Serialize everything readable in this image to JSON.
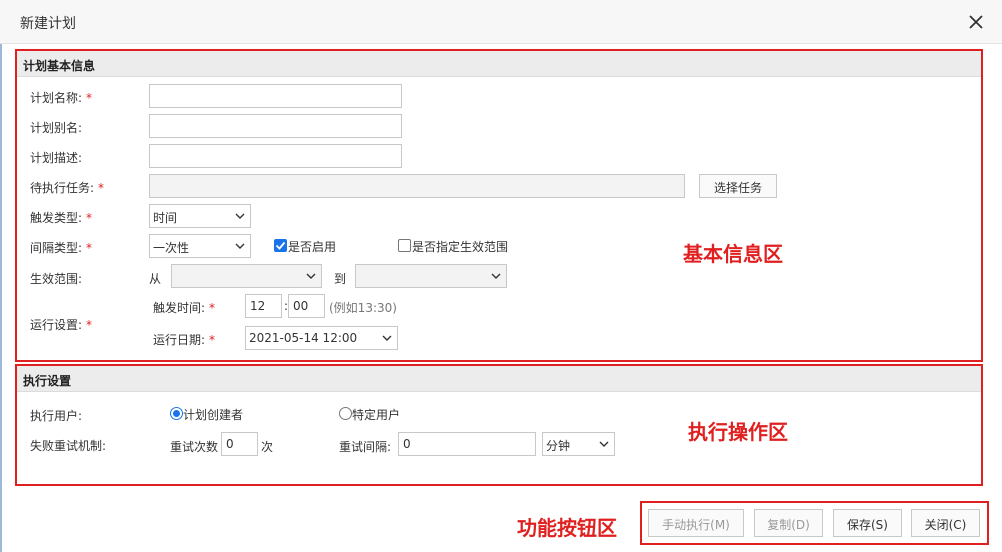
{
  "dialog": {
    "title": "新建计划"
  },
  "basic": {
    "section_title": "计划基本信息",
    "plan_name_label": "计划名称:",
    "plan_name_value": "",
    "plan_alias_label": "计划别名:",
    "plan_alias_value": "",
    "plan_desc_label": "计划描述:",
    "plan_desc_value": "",
    "pending_task_label": "待执行任务:",
    "pending_task_value": "",
    "select_task_button": "选择任务",
    "trigger_type_label": "触发类型:",
    "trigger_type_value": "时间",
    "interval_type_label": "间隔类型:",
    "interval_type_value": "一次性",
    "enable_label": "是否启用",
    "enable_checked": true,
    "specify_range_label": "是否指定生效范围",
    "specify_range_checked": false,
    "effective_range_label": "生效范围:",
    "from_label": "从",
    "to_label": "到",
    "from_value": "",
    "to_value": "",
    "run_settings_label": "运行设置:",
    "trigger_time_label": "触发时间:",
    "hour_value": "12",
    "minute_value": "00",
    "time_separator": ":",
    "time_example": "(例如13:30)",
    "run_date_label": "运行日期:",
    "run_date_value": "2021-05-14 12:00"
  },
  "exec": {
    "section_title": "执行设置",
    "exec_user_label": "执行用户:",
    "creator_option": "计划创建者",
    "creator_selected": true,
    "specific_user_option": "特定用户",
    "specific_user_selected": false,
    "retry_mech_label": "失败重试机制:",
    "retry_count_label": "重试次数",
    "retry_count_value": "0",
    "retry_count_unit": "次",
    "retry_interval_label": "重试间隔:",
    "retry_interval_value": "0",
    "interval_unit_value": "分钟"
  },
  "footer": {
    "manual_run_button": "手动执行(M)",
    "copy_button": "复制(D)",
    "save_button": "保存(S)",
    "close_button": "关闭(C)"
  },
  "annotations": {
    "basic_area": "基本信息区",
    "exec_area": "执行操作区",
    "buttons_area": "功能按钮区"
  },
  "colors": {
    "annotation_red": "#e02020",
    "accent_blue": "#1a73e8"
  },
  "icons": {
    "close": "close-icon",
    "dropdown": "chevron-down-icon",
    "checkbox": "checkbox-icon",
    "radio": "radio-icon"
  }
}
